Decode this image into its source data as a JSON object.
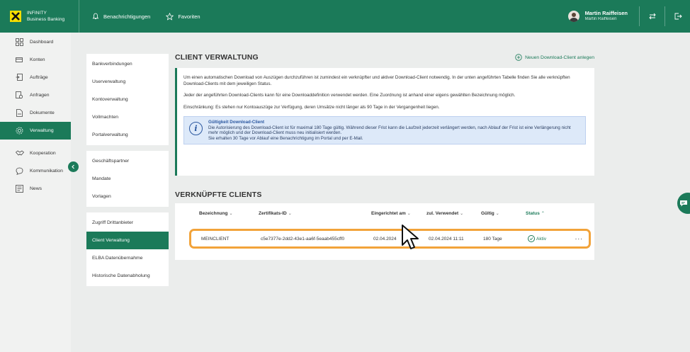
{
  "brand": {
    "line1": "INFINITY",
    "line2": "Business Banking"
  },
  "topnav": {
    "notifications": "Benachrichtigungen",
    "favorites": "Favoriten"
  },
  "user": {
    "name": "Martin Raiffeisen",
    "subtitle": "Martin Raiffeisen"
  },
  "sidebar": {
    "items": [
      {
        "label": "Dashboard",
        "icon": "dashboard-icon"
      },
      {
        "label": "Konten",
        "icon": "accounts-icon"
      },
      {
        "label": "Aufträge",
        "icon": "orders-icon"
      },
      {
        "label": "Anfragen",
        "icon": "requests-icon"
      },
      {
        "label": "Dokumente",
        "icon": "documents-icon"
      },
      {
        "label": "Verwaltung",
        "icon": "settings-icon",
        "active": true
      },
      {
        "label": "Kooperation",
        "icon": "handshake-icon"
      },
      {
        "label": "Kommunikation",
        "icon": "chat-icon"
      },
      {
        "label": "News",
        "icon": "news-icon"
      }
    ]
  },
  "subnav": {
    "groups": [
      [
        "Bankverbindungen",
        "Userverwaltung",
        "Kontoverwaltung",
        "Vollmachten",
        "Portalverwaltung"
      ],
      [
        "Geschäftspartner",
        "Mandate",
        "Vorlagen"
      ],
      [
        "Zugriff Drittanbieter",
        "Client Verwaltung",
        "ELBA Datenübernahme",
        "Historische Datenabholung"
      ]
    ],
    "active": "Client Verwaltung"
  },
  "main": {
    "title": "CLIENT VERWALTUNG",
    "new_client_link": "Neuen Download-Client anlegen",
    "info": {
      "p1": "Um einen automatischen Download von Auszügen durchzuführen ist zumindest ein verknüpfter und aktiver Download-Client notwendig. In der unten angeführten Tabelle finden Sie alle verknüpften Download-Clients mit dem jeweiligen Status.",
      "p2": "Jeder der angeführten Download-Clients kann für eine Downloaddefinition verwendet werden. Eine Zuordnung ist anhand einer eigens gewählten Bezeichnung möglich.",
      "p3": "Einschränkung: Es stehen nur Kontoauszüge zur Verfügung, deren Umsätze nicht länger als 90 Tage in der Vergangenheit liegen.",
      "note_title": "Gültigkeit Download-Client",
      "note_body": "Die Autorisierung des Download-Client ist für maximal 180 Tage gültig. Während dieser Frist kann die Laufzeit jederzeit verlängert werden, nach Ablauf der Frist ist eine Verlängerung nicht mehr möglich und der Download-Client muss neu initialisiert werden.",
      "note_body2": "Sie erhalten 30 Tage vor Ablauf eine Benachrichtigung im Portal und per E-Mail."
    }
  },
  "clients": {
    "title": "VERKNÜPFTE CLIENTS",
    "columns": {
      "name": "Bezeichnung",
      "cert": "Zertifikats-ID",
      "created": "Eingerichtet am",
      "last_used": "zul. Verwendet",
      "valid": "Gültig",
      "status": "Status"
    },
    "rows": [
      {
        "name": "MEINCLIENT",
        "cert": "c5e7377e-2dd2-43e1-aa6f-5eaab455cff0",
        "created": "02.04.2024",
        "last_used": "02.04.2024 11:11",
        "valid": "180 Tage",
        "status": "Aktiv",
        "more": "..."
      }
    ]
  },
  "colors": {
    "primary": "#1b7a59",
    "highlight": "#f2a33a",
    "note_bg": "#dde9f9",
    "brand_yellow": "#f7dd00"
  }
}
